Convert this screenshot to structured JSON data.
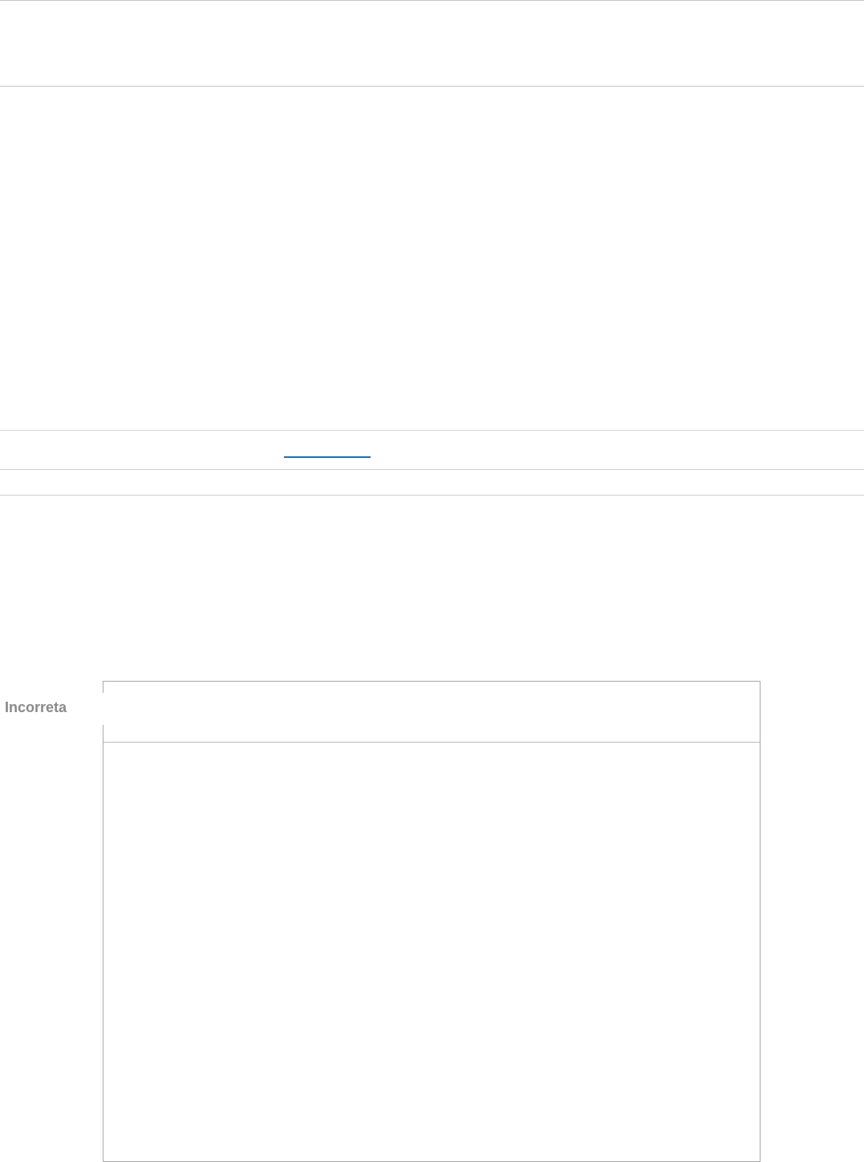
{
  "result": {
    "status_label": "Incorreta"
  },
  "link_row": {
    "link_text": ""
  },
  "answer_box": {
    "header_text": "",
    "body_text": ""
  }
}
